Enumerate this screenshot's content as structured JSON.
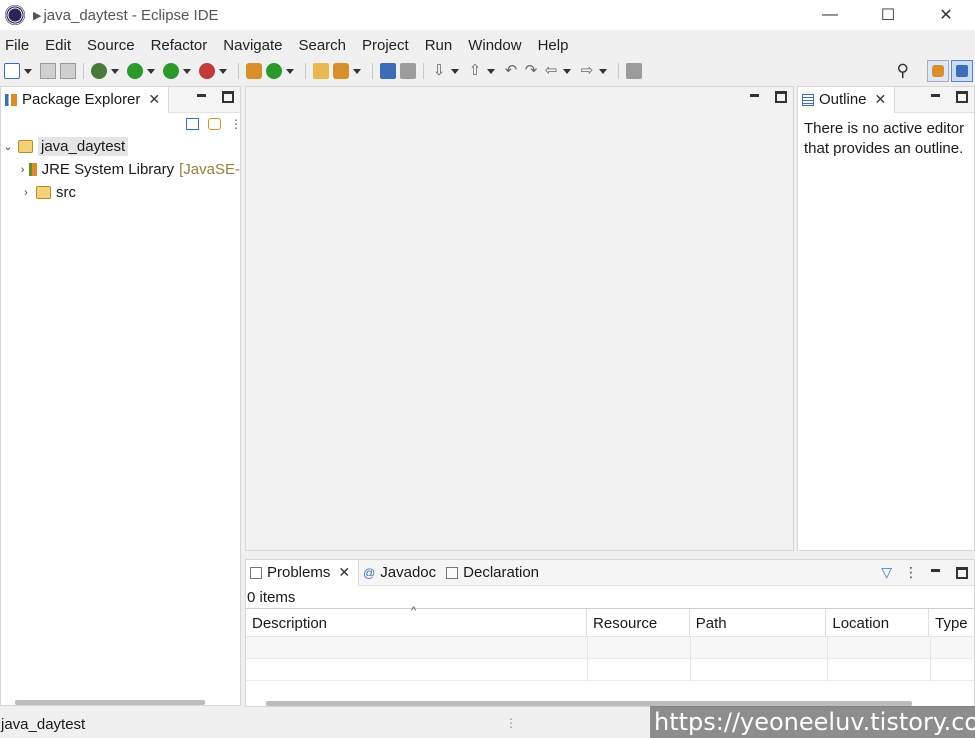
{
  "window": {
    "title": "java_daytest - Eclipse IDE",
    "controls": {
      "minimize": "—",
      "maximize": "☐",
      "close": "✕"
    }
  },
  "menubar": {
    "items": [
      "File",
      "Edit",
      "Source",
      "Refactor",
      "Navigate",
      "Search",
      "Project",
      "Run",
      "Window",
      "Help"
    ]
  },
  "toolbar": {
    "icons": [
      "new-icon",
      "save-icon",
      "save-all-icon",
      "debug-icon",
      "run-icon",
      "coverage-icon",
      "external-tools-icon",
      "new-java-project-icon",
      "new-java-package-icon",
      "new-java-class-icon",
      "open-type-icon",
      "search-icon",
      "open-task-icon",
      "toggle-mark-icon",
      "next-annotation-icon",
      "previous-annotation-icon",
      "last-edit-location-icon",
      "back-icon",
      "forward-icon",
      "pin-editor-icon"
    ],
    "right_icons": [
      "search-icon",
      "open-perspective-icon",
      "java-perspective-icon"
    ]
  },
  "package_explorer": {
    "tab_label": "Package Explorer",
    "tree": [
      {
        "label": "java_daytest",
        "expanded": true,
        "selected": true,
        "level": 0
      },
      {
        "label": "JRE System Library",
        "decoration": "[JavaSE-",
        "level": 1
      },
      {
        "label": "src",
        "level": 1
      }
    ]
  },
  "outline": {
    "tab_label": "Outline",
    "message_line1": "There is no active editor",
    "message_line2": "that provides an outline."
  },
  "bottom_panel": {
    "tabs": [
      "Problems",
      "Javadoc",
      "Declaration"
    ],
    "items_count": "0 items",
    "columns": [
      "Description",
      "Resource",
      "Path",
      "Location",
      "Type"
    ]
  },
  "statusbar": {
    "text": "java_daytest"
  },
  "watermark": {
    "text": "https://yeoneeluv.tistory.com"
  },
  "colors": {
    "accent": "#3b6db8",
    "selection": "#e5e5e5",
    "decoration": "#9a7d3c"
  }
}
